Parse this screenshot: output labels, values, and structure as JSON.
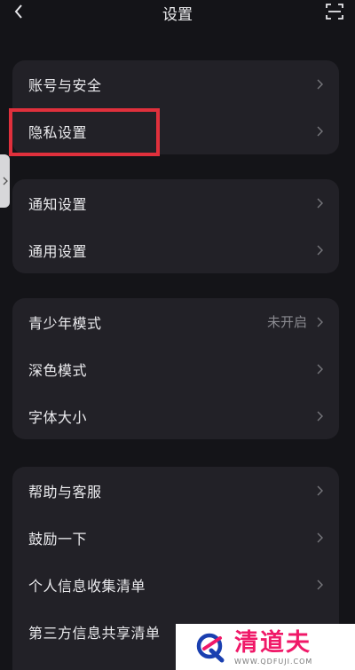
{
  "header": {
    "title": "设置",
    "back_icon": "chevron-left-icon",
    "scan_icon": "scan-icon"
  },
  "groups": [
    {
      "items": [
        {
          "label": "账号与安全"
        },
        {
          "label": "隐私设置",
          "highlighted": true
        }
      ]
    },
    {
      "items": [
        {
          "label": "通知设置"
        },
        {
          "label": "通用设置"
        }
      ]
    },
    {
      "items": [
        {
          "label": "青少年模式",
          "status": "未开启"
        },
        {
          "label": "深色模式"
        },
        {
          "label": "字体大小"
        }
      ]
    },
    {
      "items": [
        {
          "label": "帮助与客服"
        },
        {
          "label": "鼓励一下"
        },
        {
          "label": "个人信息收集清单"
        },
        {
          "label": "第三方信息共享清单"
        }
      ]
    }
  ],
  "annotation": {
    "highlight_color": "#e0303c"
  },
  "watermark": {
    "name": "清道夫",
    "url": "WWW.QDFUJI.COM",
    "brand_color": "#f01868"
  },
  "colors": {
    "background": "#141418",
    "card": "#222127",
    "text": "#ebebee",
    "muted": "#8a8a90"
  }
}
